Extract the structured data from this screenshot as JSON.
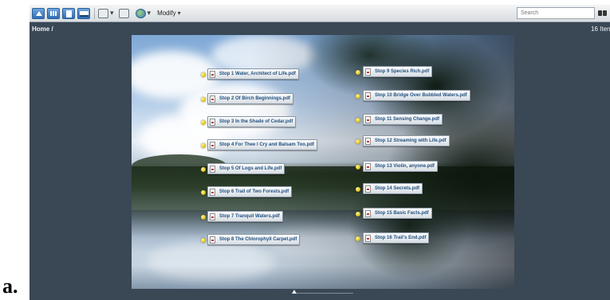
{
  "caption": "a.",
  "toolbar": {
    "modify_label": "Modify"
  },
  "search": {
    "placeholder": "Search"
  },
  "breadcrumb": "Home /",
  "item_count": "16 Iten",
  "files": [
    {
      "label": "Stop 1 Water, Architect of Life.pdf"
    },
    {
      "label": "Stop 2 Of Birch Beginnings.pdf"
    },
    {
      "label": "Stop 3 In the Shade of Cedar.pdf"
    },
    {
      "label": "Stop 4 For Thee I Cry and Balsam Too.pdf"
    },
    {
      "label": "Stop 5 Of Logs and Life.pdf"
    },
    {
      "label": "Stop 6 Trail of Two Forests.pdf"
    },
    {
      "label": "Stop 7 Tranquil Waters.pdf"
    },
    {
      "label": "Stop 8 The Chlorophyll Carpet.pdf"
    },
    {
      "label": "Stop 9 Species Rich.pdf"
    },
    {
      "label": "Stop 10 Bridge Over Bubbled Waters.pdf"
    },
    {
      "label": "Stop 11 Sensing Change.pdf"
    },
    {
      "label": "Stop 12 Streaming with Life.pdf"
    },
    {
      "label": "Stop 13 Violin, anyone.pdf"
    },
    {
      "label": "Stop 14 Secrets.pdf"
    },
    {
      "label": "Stop 15 Basic Facts.pdf"
    },
    {
      "label": "Stop 16 Trail's End.pdf"
    }
  ]
}
